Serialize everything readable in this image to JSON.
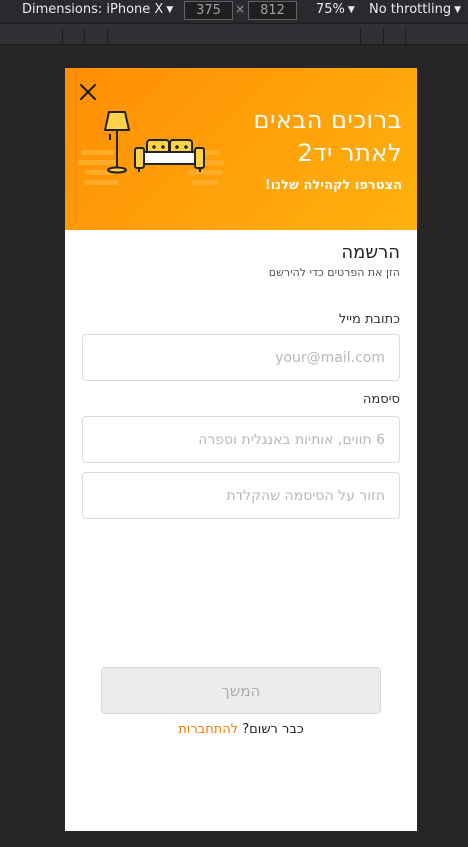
{
  "devtools": {
    "device": "Dimensions: iPhone X",
    "width": "375",
    "times": "×",
    "height": "812",
    "zoom": "75%",
    "throttling": "No throttling"
  },
  "hero": {
    "title": "ברוכים הבאים לאתר יד2",
    "subtitle": "הצטרפו לקהילה שלנו!",
    "colors": {
      "start": "#ff8d04",
      "end": "#ffb10d"
    }
  },
  "form": {
    "title": "הרשמה",
    "subtitle": "הזן את הפרטים כדי להירשם",
    "email_label": "כתובת מייל",
    "email_placeholder": "your@mail.com",
    "password_label": "סיסמה",
    "password_placeholder": "6 תווים, אותיות באנגלית וספרה",
    "confirm_placeholder": "חזור על הסיסמה שהקלדת",
    "continue_label": "המשך",
    "already_registered": "כבר רשום?",
    "login_link": "להתחברות",
    "accent": "#ee7b04"
  },
  "icons": {
    "close": "close-icon",
    "illustration": "sofa-lamp-illustration"
  }
}
